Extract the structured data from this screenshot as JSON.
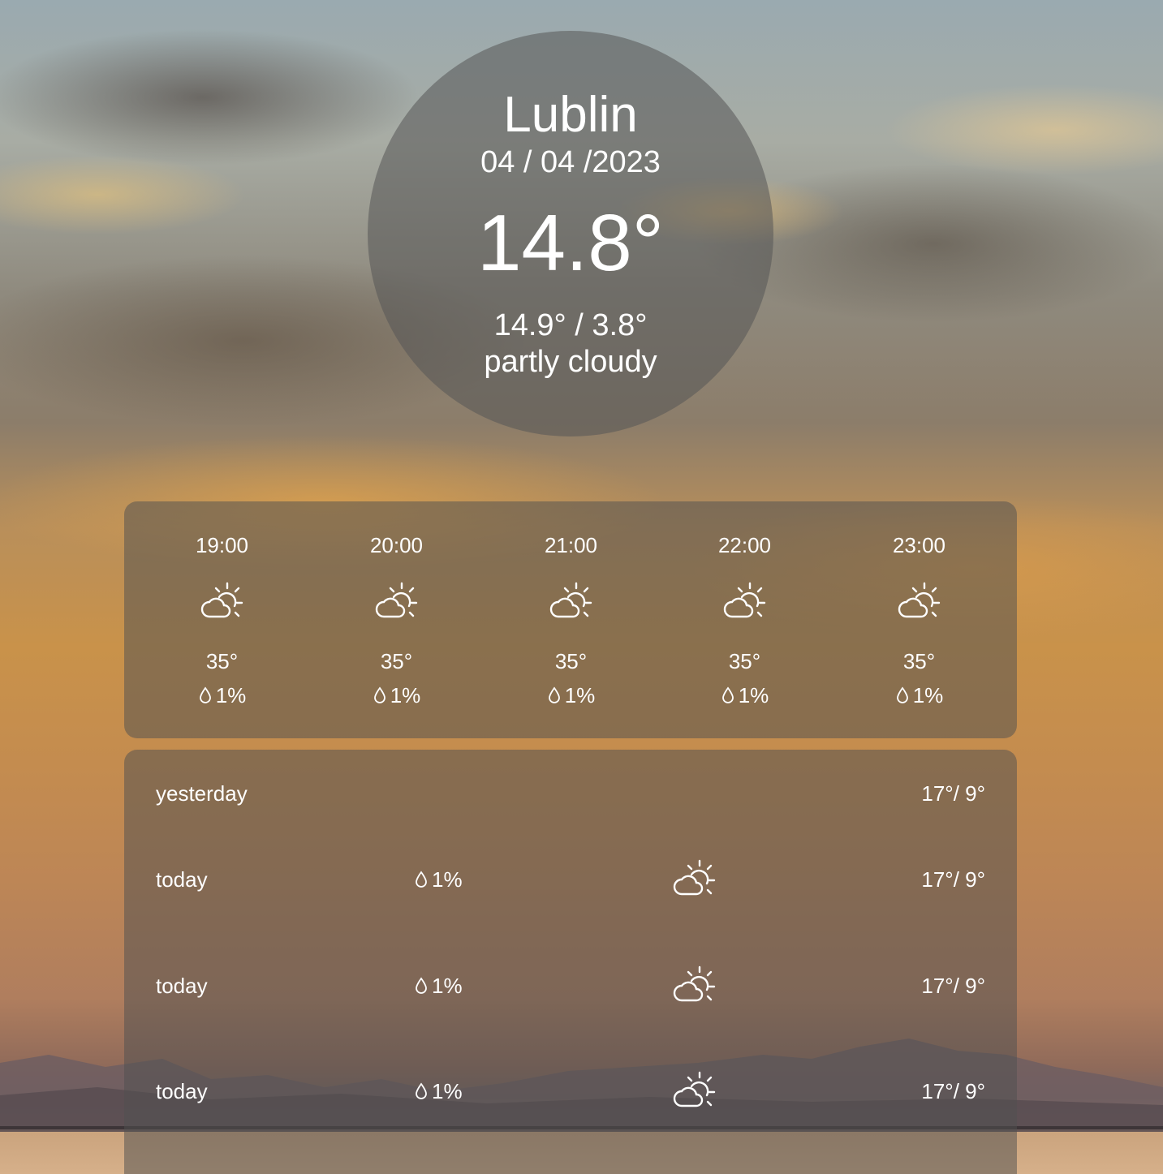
{
  "current": {
    "city": "Lublin",
    "date": "04 / 04 /2023",
    "temperature": "14.8°",
    "high_low": "14.9° / 3.8°",
    "description": "partly cloudy"
  },
  "hourly": [
    {
      "time": "19:00",
      "icon": "partly-cloudy-icon",
      "temp": "35°",
      "precip": "1%"
    },
    {
      "time": "20:00",
      "icon": "partly-cloudy-icon",
      "temp": "35°",
      "precip": "1%"
    },
    {
      "time": "21:00",
      "icon": "partly-cloudy-icon",
      "temp": "35°",
      "precip": "1%"
    },
    {
      "time": "22:00",
      "icon": "partly-cloudy-icon",
      "temp": "35°",
      "precip": "1%"
    },
    {
      "time": "23:00",
      "icon": "partly-cloudy-icon",
      "temp": "35°",
      "precip": "1%"
    }
  ],
  "daily": [
    {
      "label": "yesterday",
      "precip": "",
      "icon": "",
      "temps": "17°/ 9°"
    },
    {
      "label": "today",
      "precip": "1%",
      "icon": "partly-cloudy-icon",
      "temps": "17°/ 9°"
    },
    {
      "label": "today",
      "precip": "1%",
      "icon": "partly-cloudy-icon",
      "temps": "17°/ 9°"
    },
    {
      "label": "today",
      "precip": "1%",
      "icon": "partly-cloudy-icon",
      "temps": "17°/ 9°"
    }
  ],
  "colors": {
    "text": "#ffffff",
    "panel": "rgba(80,80,80,0.52)"
  }
}
